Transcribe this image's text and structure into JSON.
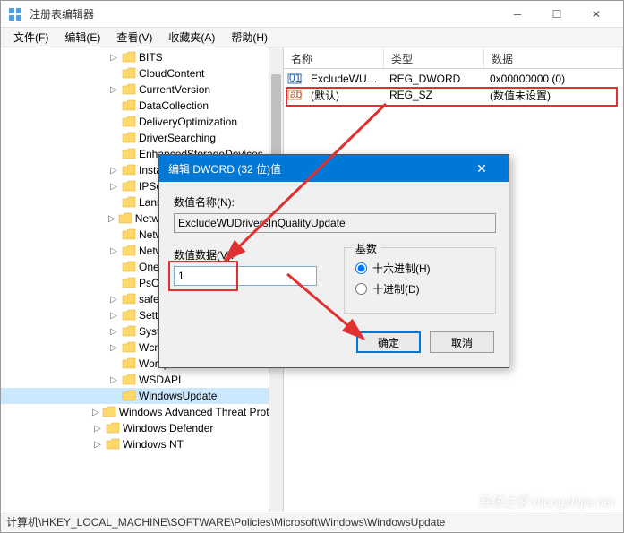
{
  "window": {
    "title": "注册表编辑器"
  },
  "menu": {
    "file": "文件(F)",
    "edit": "编辑(E)",
    "view": "查看(V)",
    "favorites": "收藏夹(A)",
    "help": "帮助(H)"
  },
  "tree": {
    "items": [
      {
        "label": "BITS",
        "indent": 3,
        "expand": "▷"
      },
      {
        "label": "CloudContent",
        "indent": 3,
        "expand": ""
      },
      {
        "label": "CurrentVersion",
        "indent": 3,
        "expand": "▷"
      },
      {
        "label": "DataCollection",
        "indent": 3,
        "expand": ""
      },
      {
        "label": "DeliveryOptimization",
        "indent": 3,
        "expand": ""
      },
      {
        "label": "DriverSearching",
        "indent": 3,
        "expand": ""
      },
      {
        "label": "EnhancedStorageDevices",
        "indent": 3,
        "expand": ""
      },
      {
        "label": "InstallService",
        "indent": 3,
        "expand": "▷"
      },
      {
        "label": "IPSec",
        "indent": 3,
        "expand": "▷"
      },
      {
        "label": "LanmanWorkstation",
        "indent": 3,
        "expand": ""
      },
      {
        "label": "NetworkConnectivityStatusIndicator",
        "indent": 3,
        "expand": "▷"
      },
      {
        "label": "NetworkProvider",
        "indent": 3,
        "expand": ""
      },
      {
        "label": "NetworkConnections",
        "indent": 3,
        "expand": "▷"
      },
      {
        "label": "OneDrive",
        "indent": 3,
        "expand": ""
      },
      {
        "label": "PsChed",
        "indent": 3,
        "expand": ""
      },
      {
        "label": "safer",
        "indent": 3,
        "expand": "▷"
      },
      {
        "label": "Settings",
        "indent": 3,
        "expand": "▷"
      },
      {
        "label": "System",
        "indent": 3,
        "expand": "▷"
      },
      {
        "label": "Wcmsvc",
        "indent": 3,
        "expand": "▷"
      },
      {
        "label": "WorkplaceJoin",
        "indent": 3,
        "expand": ""
      },
      {
        "label": "WSDAPI",
        "indent": 3,
        "expand": "▷"
      },
      {
        "label": "WindowsUpdate",
        "indent": 3,
        "expand": "",
        "selected": true
      },
      {
        "label": "Windows Advanced Threat Protection",
        "indent": 2,
        "expand": "▷"
      },
      {
        "label": "Windows Defender",
        "indent": 2,
        "expand": "▷"
      },
      {
        "label": "Windows NT",
        "indent": 2,
        "expand": "▷"
      }
    ]
  },
  "list": {
    "headers": {
      "name": "名称",
      "type": "类型",
      "data": "数据"
    },
    "rows": [
      {
        "icon": "ab",
        "name": "(默认)",
        "type": "REG_SZ",
        "data": "(数值未设置)"
      },
      {
        "icon": "011",
        "name": "ExcludeWUDri...",
        "type": "REG_DWORD",
        "data": "0x00000000 (0)"
      }
    ]
  },
  "dialog": {
    "title": "编辑 DWORD (32 位)值",
    "name_label": "数值名称(N):",
    "name_value": "ExcludeWUDriversInQualityUpdate",
    "value_label": "数值数据(V):",
    "value_value": "1",
    "radix_label": "基数",
    "radix_hex": "十六进制(H)",
    "radix_dec": "十进制(D)",
    "ok": "确定",
    "cancel": "取消"
  },
  "statusbar": {
    "path": "计算机\\HKEY_LOCAL_MACHINE\\SOFTWARE\\Policies\\Microsoft\\Windows\\WindowsUpdate"
  },
  "watermark": "系统之家 xitongzhijia.net"
}
